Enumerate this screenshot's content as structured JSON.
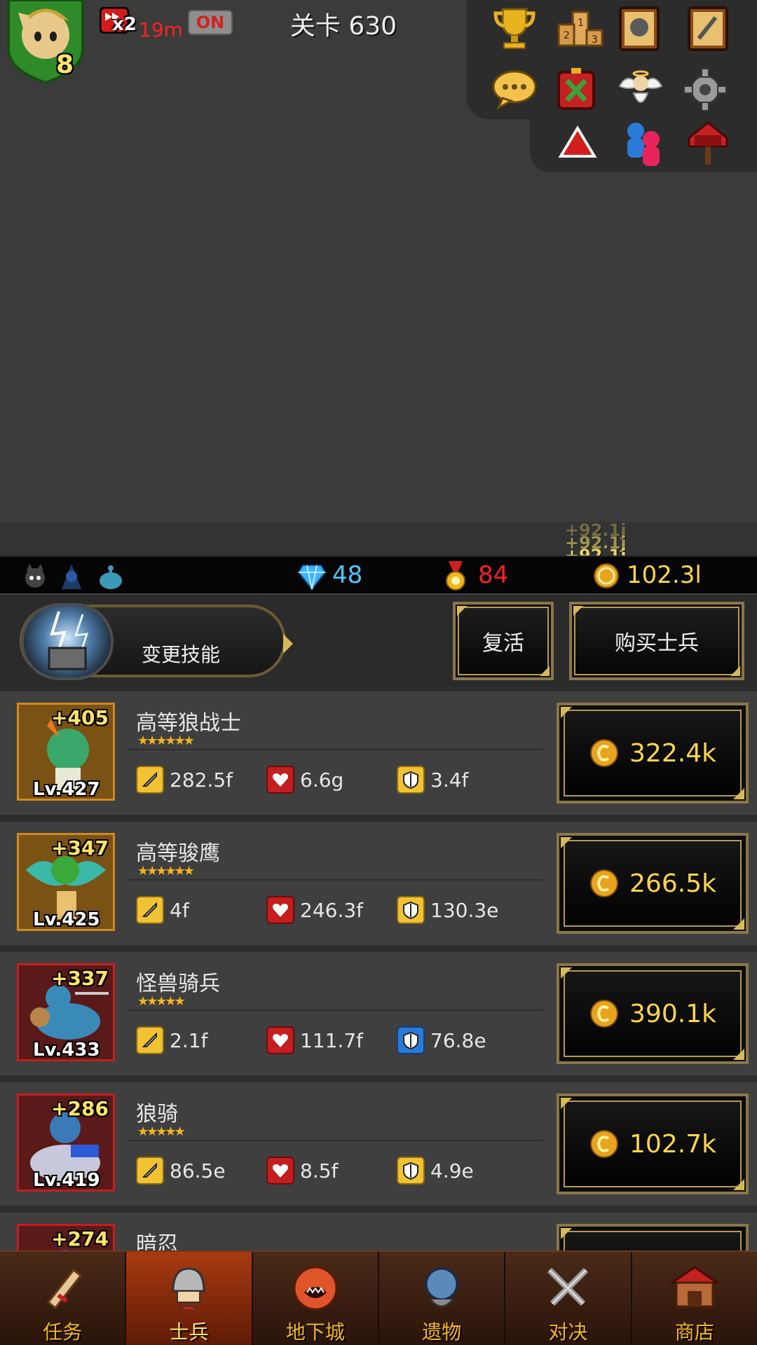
{
  "hud": {
    "player_level": "8",
    "speed_multiplier": "x2",
    "speed_time_left": "19m",
    "auto_toggle": "ON",
    "stage_label": "关卡 630"
  },
  "menu_icons": [
    "trophy-icon",
    "leaderboard-icon",
    "helmet-book-icon",
    "sword-book-icon",
    "chat-icon",
    "guild-banner-icon",
    "angel-icon",
    "gear-icon",
    "red-triangle-icon",
    "friends-icon",
    "mailbox-icon"
  ],
  "battle": {
    "coin_floats": [
      "+92.1j",
      "+92.1j",
      "+92.1j"
    ]
  },
  "resources": {
    "gems": "48",
    "medals": "84",
    "gold": "102.3l",
    "gem_color": "#4fc3ff",
    "medal_color": "#ff2020",
    "gold_color": "#ffd54a"
  },
  "actions": {
    "change_skill_label": "变更技能",
    "revive_label": "复活",
    "buy_soldier_label": "购买士兵"
  },
  "soldiers": [
    {
      "name": "高等狼战士",
      "stars": "★★★★★★",
      "plus": "+405",
      "level": "Lv.427",
      "attack": "282.5f",
      "hp": "6.6g",
      "defense": "3.4f",
      "price": "322.4k",
      "frame": "gold",
      "defense_icon": "yellow"
    },
    {
      "name": "高等骏鹰",
      "stars": "★★★★★★",
      "plus": "+347",
      "level": "Lv.425",
      "attack": "4f",
      "hp": "246.3f",
      "defense": "130.3e",
      "price": "266.5k",
      "frame": "gold",
      "defense_icon": "yellow"
    },
    {
      "name": "怪兽骑兵",
      "stars": "★★★★★",
      "plus": "+337",
      "level": "Lv.433",
      "attack": "2.1f",
      "hp": "111.7f",
      "defense": "76.8e",
      "price": "390.1k",
      "frame": "red",
      "defense_icon": "blue"
    },
    {
      "name": "狼骑",
      "stars": "★★★★★",
      "plus": "+286",
      "level": "Lv.419",
      "attack": "86.5e",
      "hp": "8.5f",
      "defense": "4.9e",
      "price": "102.7k",
      "frame": "red",
      "defense_icon": "yellow"
    },
    {
      "name": "暗忍",
      "stars": "",
      "plus": "+274",
      "level": "",
      "attack": "",
      "hp": "",
      "defense": "",
      "price": "",
      "frame": "red",
      "defense_icon": "yellow"
    }
  ],
  "nav": {
    "tabs": [
      "任务",
      "士兵",
      "地下城",
      "遗物",
      "对决",
      "商店"
    ],
    "active_index": 1
  }
}
